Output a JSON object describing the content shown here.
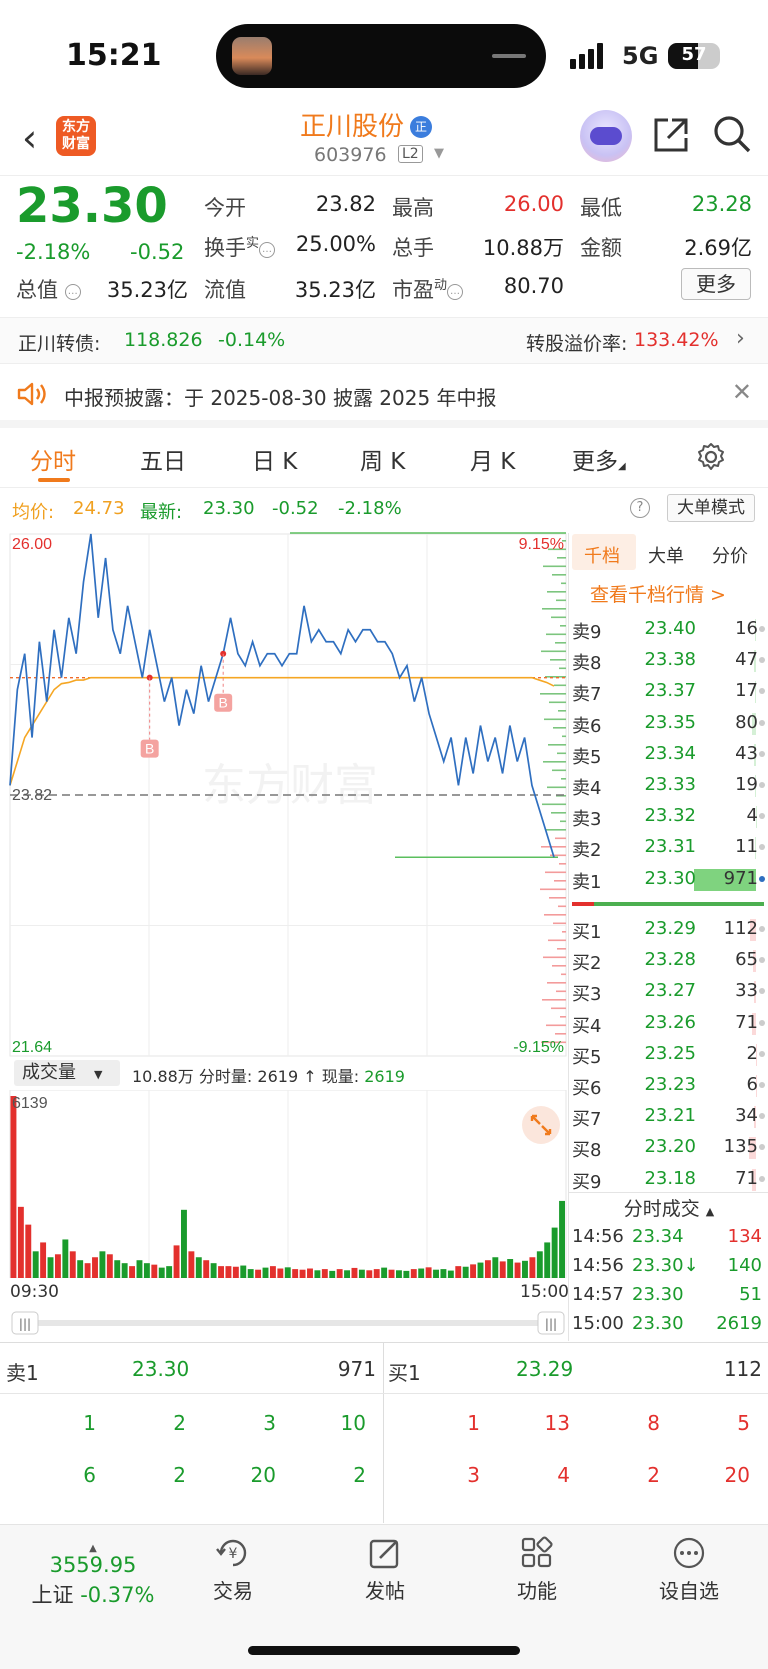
{
  "status": {
    "time": "15:21",
    "network": "5G",
    "battery": "57"
  },
  "header": {
    "logo_line1": "东方",
    "logo_line2": "财富",
    "name": "正川股份",
    "badge": "正",
    "code": "603976",
    "level": "L2"
  },
  "quote": {
    "price": "23.30",
    "pct": "-2.18%",
    "chg": "-0.52",
    "labels": {
      "open": "今开",
      "high": "最高",
      "low": "最低",
      "turnover": "换手",
      "turnover_sup": "实",
      "volume": "总手",
      "amount": "金额",
      "mktcap": "总值",
      "float": "流值",
      "pe": "市盈",
      "pe_sup": "动"
    },
    "values": {
      "open": "23.82",
      "high": "26.00",
      "low": "23.28",
      "turnover": "25.00%",
      "volume": "10.88万",
      "amount": "2.69亿",
      "mktcap": "35.23亿",
      "float": "35.23亿",
      "pe": "80.70"
    },
    "more": "更多"
  },
  "bond": {
    "name": "正川转债:",
    "price": "118.826",
    "pct": "-0.14%",
    "premium_label": "转股溢价率:",
    "premium": "133.42%"
  },
  "notice": {
    "text": "中报预披露：于 2025-08-30 披露 2025 年中报"
  },
  "tabs": [
    "分时",
    "五日",
    "日 K",
    "周 K",
    "月 K",
    "更多"
  ],
  "chart_info": {
    "avg_label": "均价:",
    "avg": "24.73",
    "latest_label": "最新:",
    "latest": "23.30",
    "chg": "-0.52",
    "pct": "-2.18%",
    "big_mode": "大单模式"
  },
  "chart_data": {
    "type": "line",
    "title": "",
    "y_max": "26.00",
    "y_min": "21.64",
    "prev_close": "23.82",
    "pct_max": "9.15%",
    "pct_min": "-9.15%",
    "ylim": [
      21.64,
      26.0
    ],
    "x_start": "09:30",
    "x_end": "15:00",
    "watermark": "东方财富",
    "buy_marker": "B",
    "series": [
      {
        "values": [
          23.9,
          24.7,
          25.0,
          24.3,
          25.1,
          24.6,
          25.2,
          24.8,
          25.3,
          25.0,
          25.6,
          26.0,
          25.3,
          25.8,
          25.2,
          25.0,
          25.4,
          25.1,
          24.8,
          25.2,
          24.9,
          24.6,
          24.8,
          24.4,
          24.7,
          24.5,
          24.9,
          24.6,
          24.8,
          25.0,
          25.3,
          25.0,
          24.9,
          25.1,
          24.9,
          25.0,
          25.0,
          24.9,
          25.0,
          25.0,
          25.4,
          25.1,
          25.2,
          25.1,
          25.1,
          25.0,
          25.2,
          25.1,
          25.2,
          25.2,
          25.1,
          25.1,
          25.0,
          24.8,
          24.9,
          24.6,
          24.8,
          24.5,
          24.3,
          24.1,
          24.3,
          23.9,
          24.3,
          24.0,
          24.4,
          24.1,
          24.3,
          24.0,
          24.4,
          24.1,
          24.3,
          23.9,
          23.7,
          23.5,
          23.3
        ]
      },
      {
        "values": [
          23.9,
          24.1,
          24.3,
          24.4,
          24.5,
          24.6,
          24.7,
          24.75,
          24.76,
          24.78,
          24.78,
          24.8,
          24.8,
          24.8,
          24.8,
          24.8,
          24.8,
          24.8,
          24.8,
          24.8,
          24.8,
          24.8,
          24.8,
          24.8,
          24.8,
          24.8,
          24.8,
          24.8,
          24.8,
          24.8,
          24.8,
          24.8,
          24.8,
          24.8,
          24.8,
          24.8,
          24.8,
          24.8,
          24.8,
          24.8,
          24.8,
          24.8,
          24.8,
          24.8,
          24.8,
          24.8,
          24.8,
          24.8,
          24.8,
          24.8,
          24.8,
          24.8,
          24.8,
          24.8,
          24.8,
          24.8,
          24.8,
          24.8,
          24.8,
          24.8,
          24.8,
          24.8,
          24.8,
          24.8,
          24.8,
          24.8,
          24.8,
          24.8,
          24.8,
          24.8,
          24.8,
          24.8,
          24.78,
          24.76,
          24.73
        ]
      }
    ],
    "volume": {
      "max_label": "6139",
      "values": [
        6139,
        2400,
        1800,
        900,
        1200,
        700,
        800,
        1300,
        900,
        600,
        500,
        700,
        900,
        800,
        600,
        500,
        400,
        600,
        500,
        450,
        350,
        400,
        1100,
        2300,
        900,
        700,
        600,
        500,
        400,
        400,
        380,
        420,
        300,
        280,
        350,
        400,
        320,
        360,
        300,
        280,
        320,
        260,
        300,
        240,
        300,
        260,
        340,
        280,
        260,
        300,
        350,
        280,
        260,
        240,
        300,
        320,
        360,
        280,
        300,
        250,
        400,
        380,
        460,
        520,
        600,
        700,
        560,
        640,
        520,
        580,
        700,
        900,
        1200,
        1700,
        2600
      ]
    }
  },
  "volume_header": {
    "selector": "成交量",
    "total": "10.88万",
    "min_label": "分时量:",
    "min_val": "2619",
    "arrow": "↑",
    "now_label": "现量:",
    "now_val": "2619"
  },
  "orderbook": {
    "tabs": [
      "千档",
      "大单",
      "分价"
    ],
    "view": "查看千档行情 >",
    "asks": [
      {
        "n": "卖9",
        "p": "23.40",
        "q": "16"
      },
      {
        "n": "卖8",
        "p": "23.38",
        "q": "47"
      },
      {
        "n": "卖7",
        "p": "23.37",
        "q": "17"
      },
      {
        "n": "卖6",
        "p": "23.35",
        "q": "80"
      },
      {
        "n": "卖5",
        "p": "23.34",
        "q": "43"
      },
      {
        "n": "卖4",
        "p": "23.33",
        "q": "19"
      },
      {
        "n": "卖3",
        "p": "23.32",
        "q": "4"
      },
      {
        "n": "卖2",
        "p": "23.31",
        "q": "11"
      },
      {
        "n": "卖1",
        "p": "23.30",
        "q": "971"
      }
    ],
    "bids": [
      {
        "n": "买1",
        "p": "23.29",
        "q": "112"
      },
      {
        "n": "买2",
        "p": "23.28",
        "q": "65"
      },
      {
        "n": "买3",
        "p": "23.27",
        "q": "33"
      },
      {
        "n": "买4",
        "p": "23.26",
        "q": "71"
      },
      {
        "n": "买5",
        "p": "23.25",
        "q": "2"
      },
      {
        "n": "买6",
        "p": "23.23",
        "q": "6"
      },
      {
        "n": "买7",
        "p": "23.21",
        "q": "34"
      },
      {
        "n": "买8",
        "p": "23.20",
        "q": "135"
      },
      {
        "n": "买9",
        "p": "23.18",
        "q": "71"
      }
    ]
  },
  "trades": {
    "title": "分时成交",
    "rows": [
      {
        "t": "14:56",
        "p": "23.34",
        "v": "134",
        "c": "red"
      },
      {
        "t": "14:56",
        "p": "23.30↓",
        "v": "140",
        "c": "green"
      },
      {
        "t": "14:57",
        "p": "23.30",
        "v": "51",
        "c": "green"
      },
      {
        "t": "15:00",
        "p": "23.30",
        "v": "2619",
        "c": "green"
      }
    ]
  },
  "queue": {
    "ask_label": "卖1",
    "ask_price": "23.30",
    "ask_qty": "971",
    "bid_label": "买1",
    "bid_price": "23.29",
    "bid_qty": "112",
    "ask_orders": [
      "1",
      "2",
      "3",
      "10",
      "6",
      "2",
      "20",
      "2"
    ],
    "bid_orders": [
      "1",
      "13",
      "8",
      "5",
      "3",
      "4",
      "2",
      "20"
    ]
  },
  "nav": {
    "index_value": "3559.95",
    "index_name": "上证",
    "index_pct": "-0.37%",
    "items": [
      "交易",
      "发帖",
      "功能",
      "设自选"
    ]
  }
}
